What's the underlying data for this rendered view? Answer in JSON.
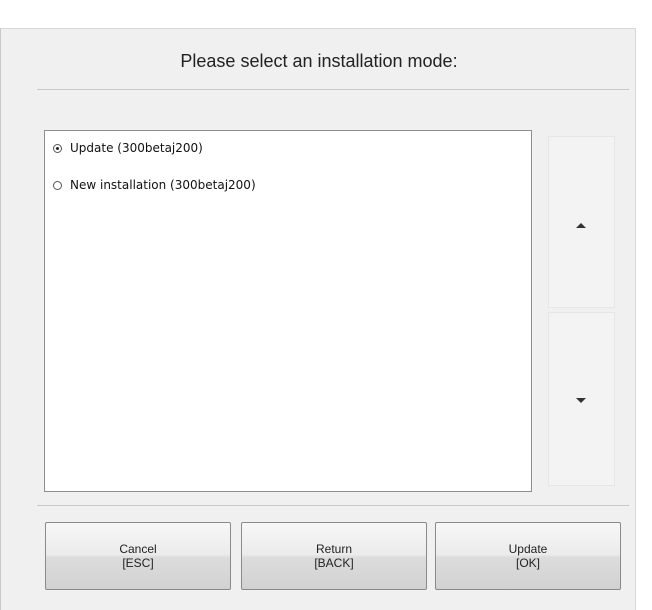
{
  "dialog": {
    "title": "Please select an installation mode:"
  },
  "options": [
    {
      "label": "Update (300betaj200)",
      "selected": true
    },
    {
      "label": "New installation (300betaj200)",
      "selected": false
    }
  ],
  "scroll": {
    "up_icon": "arrow-up-icon",
    "down_icon": "arrow-down-icon"
  },
  "buttons": {
    "cancel": {
      "label": "Cancel",
      "key": "[ESC]"
    },
    "return": {
      "label": "Return",
      "key": "[BACK]"
    },
    "update": {
      "label": "Update",
      "key": "[OK]"
    }
  }
}
